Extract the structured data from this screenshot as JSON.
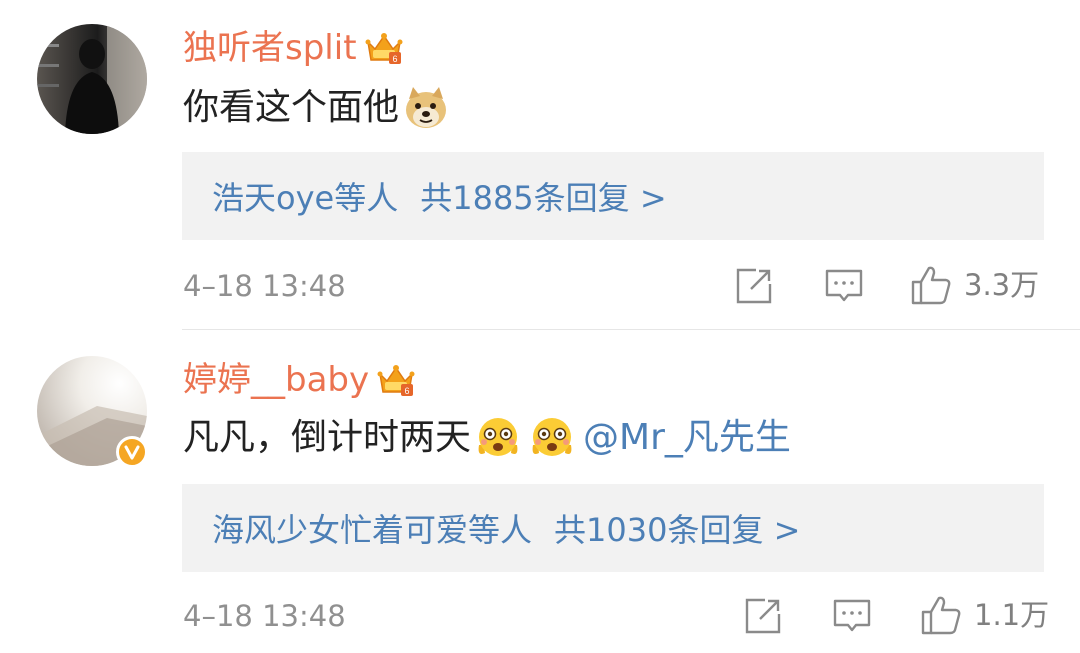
{
  "comments": [
    {
      "username": "独听者split",
      "content_text": "你看这个面他",
      "mention": "",
      "replies": {
        "names": "浩天oye等人",
        "count": "共1885条回复 >"
      },
      "time": "4–18 13:48",
      "likes": "3.3万"
    },
    {
      "username": "婷婷__baby",
      "content_text": "凡凡，倒计时两天",
      "mention": "@Mr_凡先生",
      "replies": {
        "names": "海风少女忙着可爱等人",
        "count": "共1030条回复 >"
      },
      "time": "4–18 13:48",
      "likes": "1.1万"
    }
  ],
  "icons": {
    "crown": "crown-vip-icon",
    "doge": "doge-emoji-icon",
    "grin": "grin-emoji-icon",
    "share": "share-icon",
    "comment": "comment-icon",
    "like": "thumbs-up-icon",
    "verified": "verified-v-icon"
  },
  "colors": {
    "username": "#eb7350",
    "link": "#4c7fb6",
    "verified": "#f5a623",
    "reply_bg": "#f2f2f2"
  }
}
